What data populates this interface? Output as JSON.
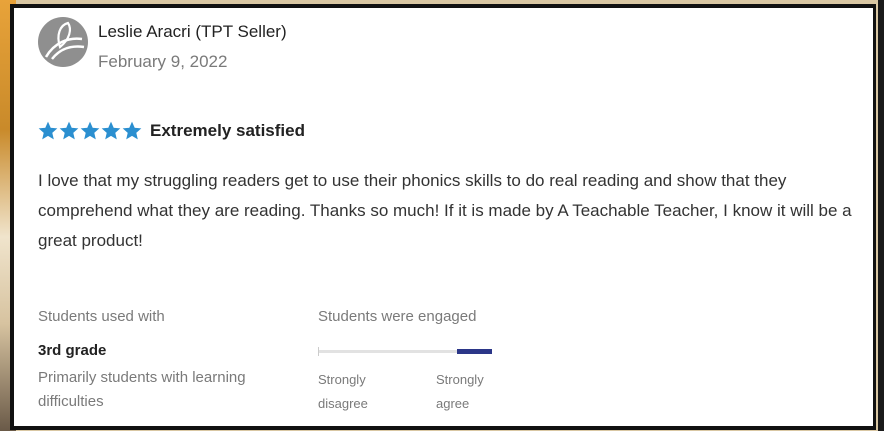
{
  "review": {
    "reviewer_name": "Leslie Aracri (TPT Seller)",
    "date": "February 9, 2022",
    "rating": 5,
    "rating_max": 5,
    "rating_label": "Extremely satisfied",
    "text": "I love that my struggling readers get to use their phonics skills to do real reading and show that they comprehend what they are reading. Thanks so much! If it is made by A Teachable Teacher, I know it will be a great product!"
  },
  "students_used_with": {
    "heading": "Students used with",
    "grade": "3rd grade",
    "detail": "Primarily students with learning difficulties"
  },
  "engagement": {
    "heading": "Students were engaged",
    "level": 1.0,
    "low_label": "Strongly disagree",
    "high_label": "Strongly agree"
  },
  "colors": {
    "star": "#2b8fd0",
    "scale_fill": "#2b3688",
    "avatar": "#8f8f8f",
    "card_border": "#111111"
  },
  "icons": {
    "avatar": "leaf-logo-icon",
    "star": "star-icon"
  }
}
